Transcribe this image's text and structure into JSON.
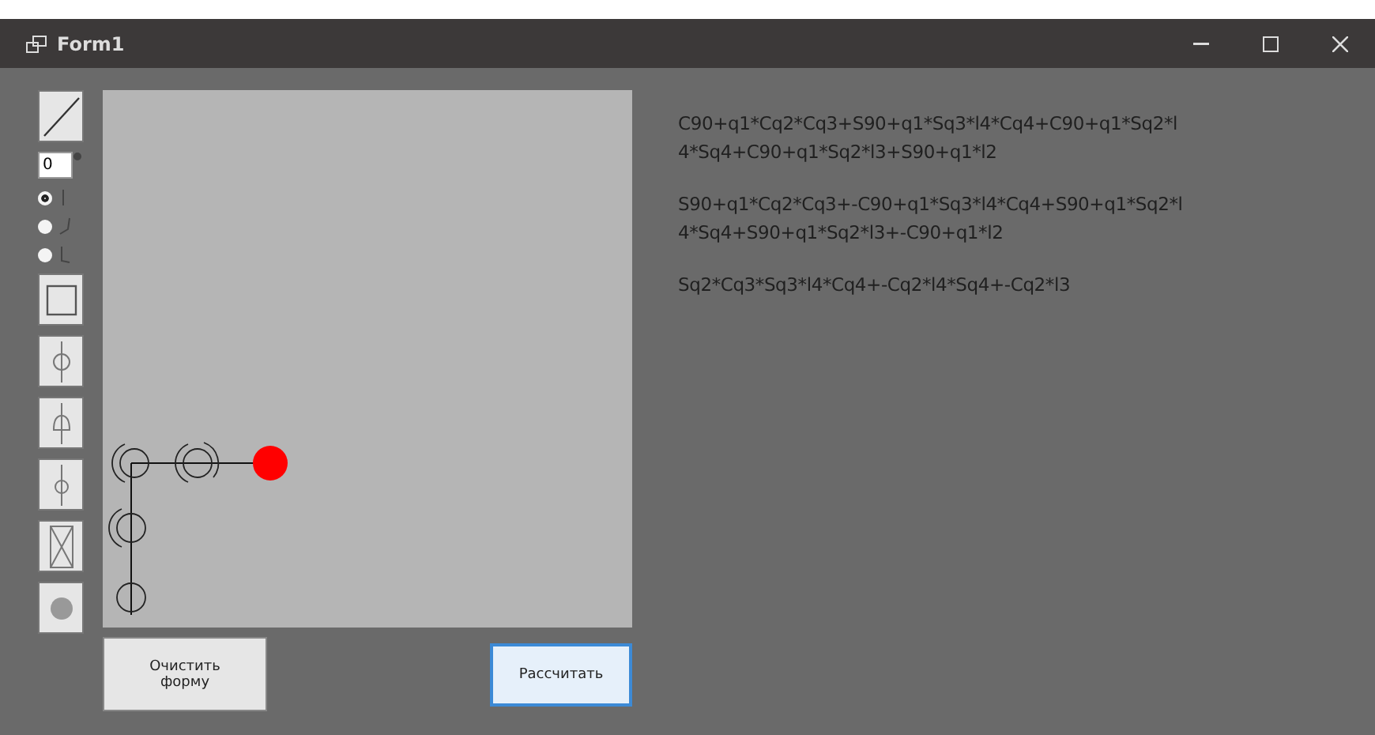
{
  "window": {
    "title": "Form1"
  },
  "toolbar": [
    {
      "kind": "tool"
    },
    {
      "kind": "number",
      "value": "0"
    },
    {
      "kind": "radio",
      "selected": true
    },
    {
      "kind": "radio",
      "selected": false
    },
    {
      "kind": "radio",
      "selected": false
    },
    {
      "kind": "tool"
    },
    {
      "kind": "tool"
    },
    {
      "kind": "tool"
    },
    {
      "kind": "tool"
    },
    {
      "kind": "tool"
    },
    {
      "kind": "tool"
    }
  ],
  "buttons": [
    {
      "label": "Очистить форму",
      "focused": false
    },
    {
      "label": "Рассчитать",
      "focused": true
    }
  ],
  "formulas": [
    {
      "lines": [
        "C90+q1*Cq2*Cq3+S90+q1*Sq3*l4*Cq4+C90+q1*Sq2*l",
        "4*Sq4+C90+q1*Sq2*l3+S90+q1*l2"
      ]
    },
    {
      "lines": [
        "S90+q1*Cq2*Cq3+-C90+q1*Sq3*l4*Cq4+S90+q1*Sq2*l",
        "4*Sq4+S90+q1*Sq2*l3+-C90+q1*l2"
      ]
    },
    {
      "lines": [
        "Sq2*Cq3*Sq3*l4*Cq4+-Cq2*l4*Sq4+-Cq2*l3"
      ]
    }
  ]
}
